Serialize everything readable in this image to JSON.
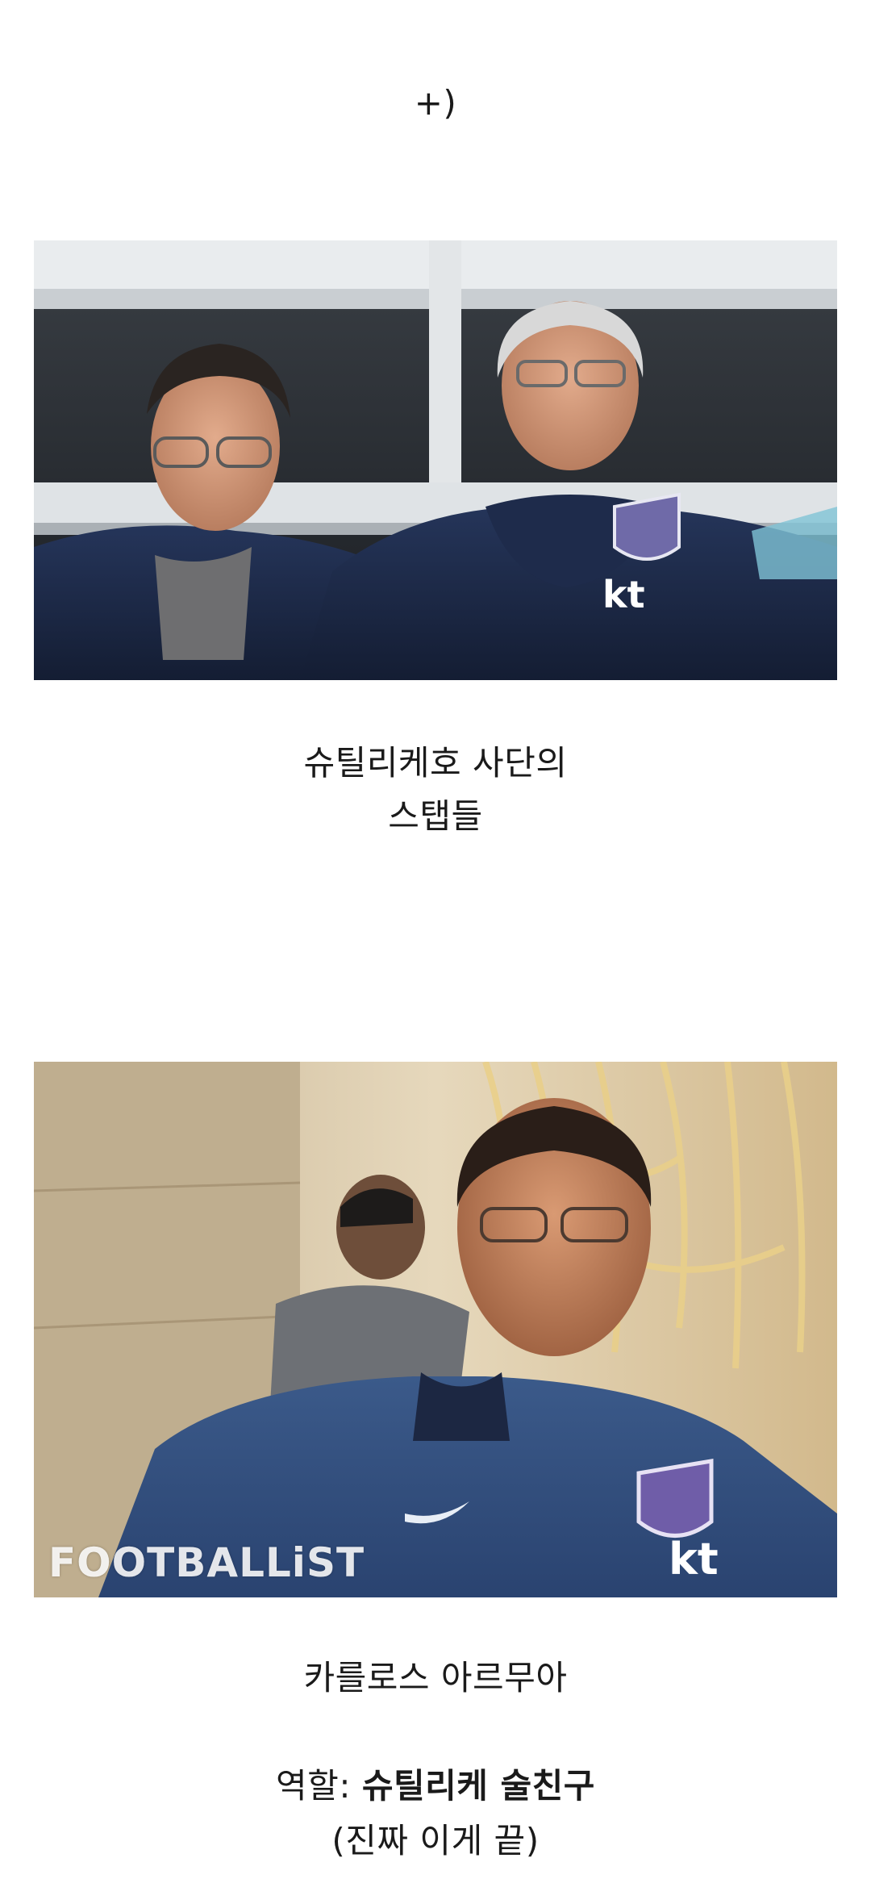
{
  "header": {
    "top_note": "+)"
  },
  "photo1": {
    "alt": "슈틸리케호 사단의 스탭들",
    "caption_line1": "슈틸리케호 사단의",
    "caption_line2": "스탭들",
    "logo_text": "kt"
  },
  "photo2": {
    "watermark": "FOOTBALLiST",
    "logo_text": "kt",
    "name": "카를로스 아르무아"
  },
  "role": {
    "prefix": "역할: ",
    "value": "슈틸리케 술친구",
    "note": "(진짜 이게 끝)"
  },
  "colors": {
    "navy_jacket": "#1c2a4a",
    "stadium_rail": "#e9ecee",
    "cafe_wall": "#d9c8a6"
  }
}
